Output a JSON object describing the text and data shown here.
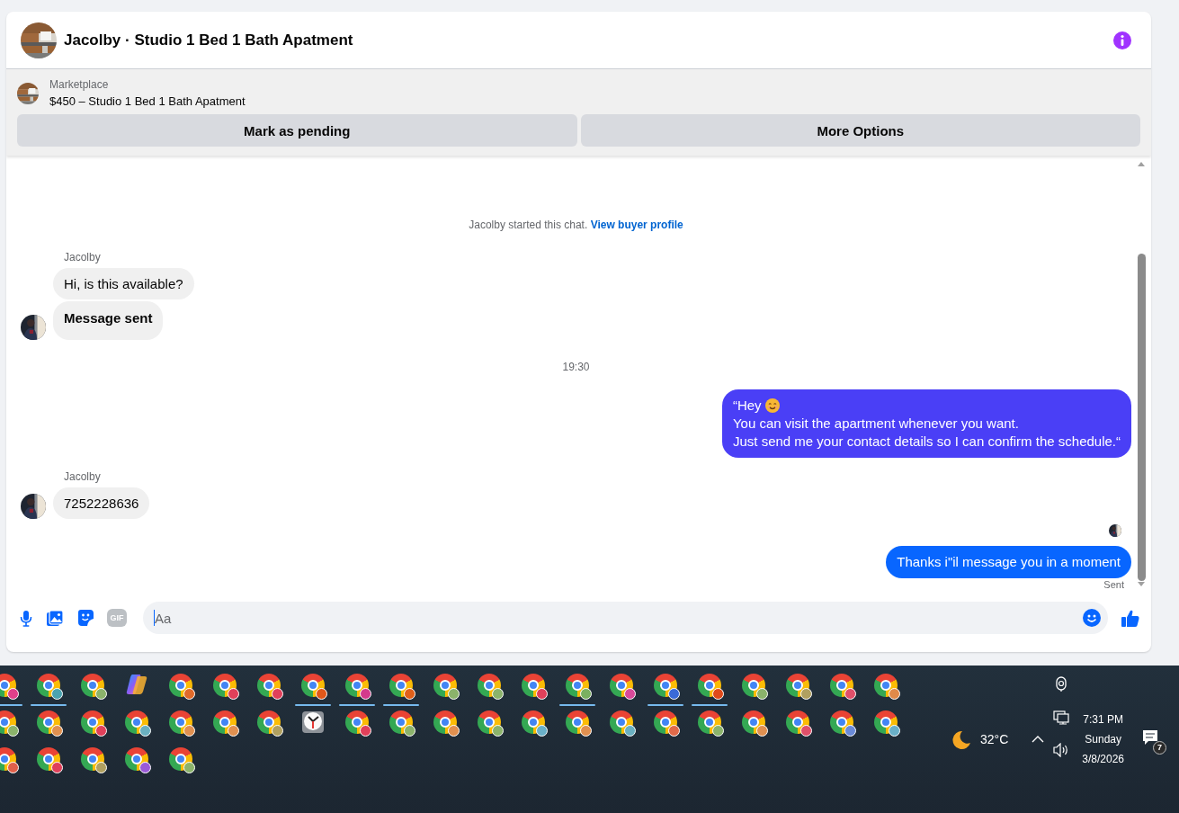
{
  "chat": {
    "title": "Jacolby · Studio 1 Bed 1 Bath Apatment",
    "listing": {
      "source": "Marketplace",
      "summary": "$450 – Studio 1 Bed 1 Bath Apatment"
    },
    "actions": [
      "Mark as pending",
      "More Options"
    ],
    "messages": [
      {
        "kind": "intro",
        "text": "Jacolby started this chat.",
        "link": "View buyer profile"
      },
      {
        "kind": "sender",
        "text": "Jacolby"
      },
      {
        "kind": "incoming",
        "bold": false,
        "avatar": false,
        "lines": [
          {
            "text": "Hi, is this available?",
            "emoji": false
          }
        ]
      },
      {
        "kind": "incoming",
        "bold": true,
        "avatar": true,
        "lines": [
          {
            "text": "Message sent",
            "emoji": false
          }
        ]
      },
      {
        "kind": "time",
        "text": "19:30"
      },
      {
        "kind": "outgoing",
        "color": "#4a3ff6",
        "lines": [
          {
            "text": "“Hey",
            "emoji": true
          },
          {
            "text": "You can visit the apartment whenever you want.",
            "emoji": false
          },
          {
            "text": "Just send me your contact details so I can confirm the schedule.“",
            "emoji": false
          }
        ]
      },
      {
        "kind": "sender",
        "text": "Jacolby"
      },
      {
        "kind": "incoming",
        "bold": false,
        "avatar": true,
        "lines": [
          {
            "text": "7252228636",
            "emoji": false
          }
        ]
      },
      {
        "kind": "seen"
      },
      {
        "kind": "outgoing",
        "color": "#0866ff",
        "lines": [
          {
            "text": "Thanks i\"il message you in a moment",
            "emoji": false
          }
        ]
      },
      {
        "kind": "status",
        "text": "Sent"
      }
    ],
    "composer": {
      "placeholder": "Aa",
      "gif_label": "GIF"
    }
  },
  "taskbar": {
    "rows": [
      [
        {
          "kind": "chrome",
          "color": "#e0408a",
          "running": true
        },
        {
          "kind": "chrome",
          "color": "#4aa3b0",
          "running": true
        },
        {
          "kind": "chrome",
          "color": "#8bb36b",
          "running": false
        },
        {
          "kind": "copilot",
          "running": false
        },
        {
          "kind": "chrome",
          "color": "#e06a2a",
          "running": false
        },
        {
          "kind": "chrome",
          "color": "#e0405a",
          "running": false
        },
        {
          "kind": "chrome",
          "color": "#e0405a",
          "running": false
        },
        {
          "kind": "chrome",
          "color": "#e0581a",
          "running": true
        },
        {
          "kind": "chrome",
          "color": "#d43a8c",
          "running": true
        },
        {
          "kind": "chrome",
          "color": "#e0601a",
          "running": true
        },
        {
          "kind": "chrome",
          "color": "#8bb36b",
          "running": false
        },
        {
          "kind": "chrome",
          "color": "#8bb36b",
          "running": false
        },
        {
          "kind": "chrome",
          "color": "#e0405a",
          "running": false
        },
        {
          "kind": "chrome",
          "color": "#7ab060",
          "running": true
        },
        {
          "kind": "chrome",
          "color": "#d84a9a",
          "running": false
        },
        {
          "kind": "chrome",
          "color": "#3a6ad8",
          "running": true
        },
        {
          "kind": "chrome",
          "color": "#e04a1a",
          "running": true
        },
        {
          "kind": "chrome",
          "color": "#8bb36b",
          "running": false
        },
        {
          "kind": "chrome",
          "color": "#b0a060",
          "running": false
        },
        {
          "kind": "chrome",
          "color": "#e0506a",
          "running": false
        },
        {
          "kind": "chrome",
          "color": "#e08a4a",
          "running": false
        }
      ],
      [
        {
          "kind": "chrome",
          "color": "#8bb36b",
          "running": false
        },
        {
          "kind": "chrome",
          "color": "#e09050",
          "running": false
        },
        {
          "kind": "chrome",
          "color": "#e0405a",
          "running": false
        },
        {
          "kind": "chrome",
          "color": "#6ab0c0",
          "running": false
        },
        {
          "kind": "chrome",
          "color": "#e09050",
          "running": false
        },
        {
          "kind": "chrome",
          "color": "#e09050",
          "running": false
        },
        {
          "kind": "chrome",
          "color": "#b0a060",
          "running": false
        },
        {
          "kind": "clock",
          "running": false
        },
        {
          "kind": "chrome",
          "color": "#e0405a",
          "running": false
        },
        {
          "kind": "chrome",
          "color": "#8bb36b",
          "running": false
        },
        {
          "kind": "chrome",
          "color": "#e09050",
          "running": false
        },
        {
          "kind": "chrome",
          "color": "#8bb36b",
          "running": false
        },
        {
          "kind": "chrome",
          "color": "#6ab0c8",
          "running": false
        },
        {
          "kind": "chrome",
          "color": "#e09050",
          "running": false
        },
        {
          "kind": "chrome",
          "color": "#6ab0c0",
          "running": false
        },
        {
          "kind": "chrome",
          "color": "#e06a4a",
          "running": false
        },
        {
          "kind": "chrome",
          "color": "#8bb36b",
          "running": false
        },
        {
          "kind": "chrome",
          "color": "#e09050",
          "running": false
        },
        {
          "kind": "chrome",
          "color": "#e0506a",
          "running": false
        },
        {
          "kind": "chrome",
          "color": "#6a8ad8",
          "running": false
        },
        {
          "kind": "chrome",
          "color": "#6ab0c8",
          "running": false
        }
      ],
      [
        {
          "kind": "chrome",
          "color": "#e0604a",
          "running": false
        },
        {
          "kind": "chrome",
          "color": "#e0405a",
          "running": false
        },
        {
          "kind": "chrome",
          "color": "#b0a060",
          "running": false
        },
        {
          "kind": "chrome",
          "color": "#9a5ad8",
          "running": false
        },
        {
          "kind": "chrome",
          "color": "#8bb36b",
          "running": false
        }
      ]
    ],
    "weather": {
      "temp": "32°C"
    },
    "clock": {
      "time": "7:31 PM",
      "day": "Sunday",
      "date": "3/8/2026"
    },
    "notifications": {
      "count": "7"
    }
  }
}
